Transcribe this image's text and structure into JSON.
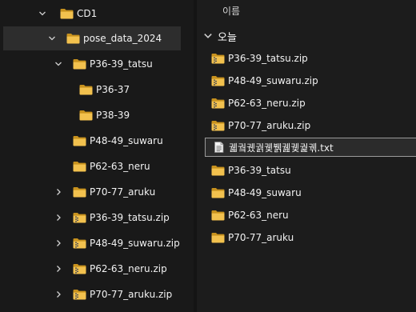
{
  "left_tree": {
    "items": [
      {
        "label": "CD1",
        "icon": "folder-icon",
        "chevron": "down"
      },
      {
        "label": "pose_data_2024",
        "icon": "folder-icon",
        "chevron": "down",
        "selected": true
      },
      {
        "label": "P36-39_tatsu",
        "icon": "folder-icon",
        "chevron": "down"
      },
      {
        "label": "P36-37",
        "icon": "folder-icon",
        "chevron": "none"
      },
      {
        "label": "P38-39",
        "icon": "folder-icon",
        "chevron": "none"
      },
      {
        "label": "P48-49_suwaru",
        "icon": "folder-icon",
        "chevron": "none"
      },
      {
        "label": "P62-63_neru",
        "icon": "folder-icon",
        "chevron": "none"
      },
      {
        "label": "P70-77_aruku",
        "icon": "folder-icon",
        "chevron": "right"
      },
      {
        "label": "P36-39_tatsu.zip",
        "icon": "zip-folder-icon",
        "chevron": "right"
      },
      {
        "label": "P48-49_suwaru.zip",
        "icon": "zip-folder-icon",
        "chevron": "right"
      },
      {
        "label": "P62-63_neru.zip",
        "icon": "zip-folder-icon",
        "chevron": "right"
      },
      {
        "label": "P70-77_aruku.zip",
        "icon": "zip-folder-icon",
        "chevron": "right"
      }
    ]
  },
  "file_list": {
    "column_name": "이름",
    "group_label": "오늘",
    "items": [
      {
        "label": "P36-39_tatsu.zip",
        "icon": "zip-folder-icon"
      },
      {
        "label": "P48-49_suwaru.zip",
        "icon": "zip-folder-icon"
      },
      {
        "label": "P62-63_neru.zip",
        "icon": "zip-folder-icon"
      },
      {
        "label": "P70-77_aruku.zip",
        "icon": "zip-folder-icon"
      },
      {
        "label": "궯궠궸궑궻뷁궲궻궕궦.txt",
        "icon": "text-file-icon",
        "selected": true
      },
      {
        "label": "P36-39_tatsu",
        "icon": "folder-icon"
      },
      {
        "label": "P48-49_suwaru",
        "icon": "folder-icon"
      },
      {
        "label": "P62-63_neru",
        "icon": "folder-icon"
      },
      {
        "label": "P70-77_aruku",
        "icon": "folder-icon"
      }
    ]
  },
  "colors": {
    "folder": "#e8b53c",
    "folder_dark": "#c8921e",
    "background": "#1c1c1c",
    "selection": "#2d2d2d"
  }
}
